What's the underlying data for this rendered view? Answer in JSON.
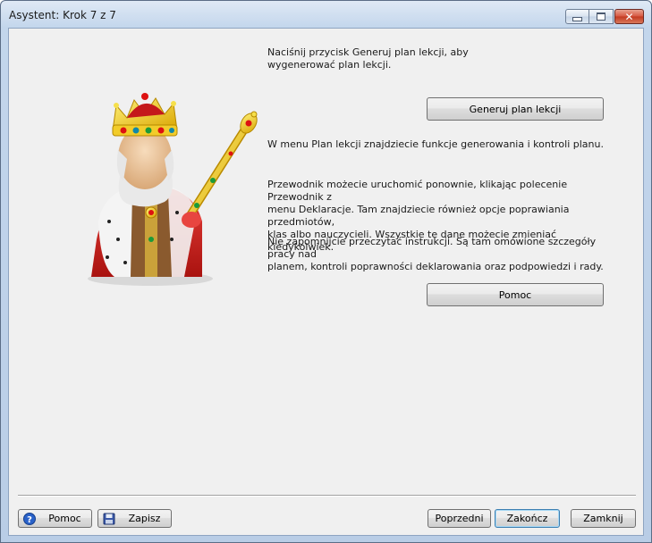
{
  "window": {
    "title": "Asystent: Krok 7 z 7",
    "controls": {
      "minimize": "minimize",
      "maximize": "maximize",
      "close": "close"
    }
  },
  "content": {
    "intro_text": "Naciśnij przycisk Generuj plan lekcji, aby\nwygenerować plan lekcji.",
    "generate_button": "Generuj plan lekcji",
    "menu_text": "W menu Plan lekcji znajdziecie funkcje generowania i kontroli planu.",
    "guide_text": "Przewodnik możecie uruchomić ponownie, klikając polecenie Przewodnik z\nmenu Deklaracje. Tam znajdziecie również opcje poprawiania przedmiotów,\nklas albo nauczycieli. Wszystkie te dane możecie zmieniać kiedykolwiek.",
    "instructions_text": "Nie zapomnijcie przeczytać instrukcji. Są tam omówione szczegóły pracy nad\nplanem, kontroli poprawności deklarowania oraz podpowiedzi i rady.",
    "help_button": "Pomoc"
  },
  "footer": {
    "help_button": "Pomoc",
    "save_button": "Zapisz",
    "previous_button": "Poprzedni",
    "finish_button": "Zakończ",
    "close_button": "Zamknij",
    "icons": {
      "help": "help-icon",
      "save": "floppy-disk-icon"
    }
  },
  "colors": {
    "titlebar": "#c3d6ec",
    "client_bg": "#f0f0f0",
    "close_button": "#c2381f",
    "default_button_border": "#3c7fb1"
  }
}
